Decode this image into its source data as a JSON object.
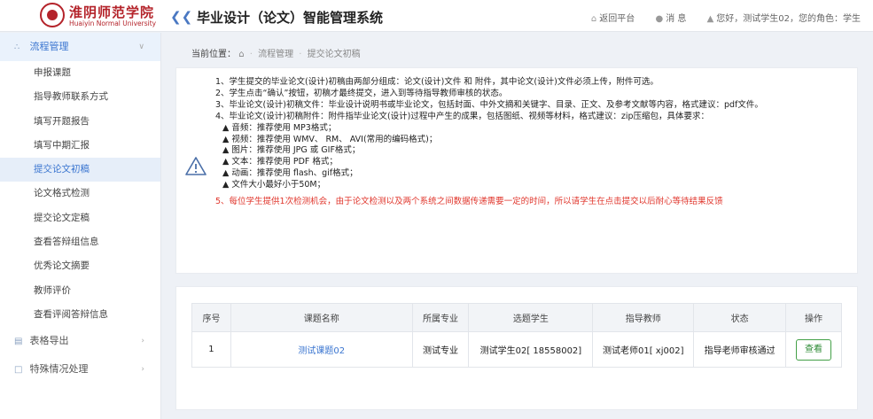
{
  "header": {
    "logo_cn": "淮阴师范学院",
    "logo_en": "Huaiyin Normal University",
    "app_title": "毕业设计（论文）智能管理系统",
    "return_label": "返回平台",
    "messages_label": "消 息",
    "user_greeting": "您好，测试学生02，您的角色：学生"
  },
  "sidebar": {
    "groups": [
      {
        "label": "流程管理",
        "icon": "share-icon"
      },
      {
        "label": "表格导出",
        "icon": "table-icon"
      },
      {
        "label": "特殊情况处理",
        "icon": "document-icon"
      }
    ],
    "items": [
      {
        "label": "申报课题"
      },
      {
        "label": "指导教师联系方式"
      },
      {
        "label": "填写开题报告"
      },
      {
        "label": "填写中期汇报"
      },
      {
        "label": "提交论文初稿"
      },
      {
        "label": "论文格式检测"
      },
      {
        "label": "提交论文定稿"
      },
      {
        "label": "查看答辩组信息"
      },
      {
        "label": "优秀论文摘要"
      },
      {
        "label": "教师评价"
      },
      {
        "label": "查看评阅答辩信息"
      }
    ]
  },
  "breadcrumb": {
    "prefix": "当前位置：",
    "level1": "流程管理",
    "level2": "提交论文初稿"
  },
  "notice": {
    "lines": [
      "1、学生提交的毕业论文(设计)初稿由两部分组成：论文(设计)文件 和 附件，其中论文(设计)文件必须上传，附件可选。",
      "2、学生点击“确认”按钮，初稿才最终提交，进入到等待指导教师审核的状态。",
      "3、毕业论文(设计)初稿文件：毕业设计说明书或毕业论文，包括封面、中外文摘和关键字、目录、正文、及参考文献等内容，格式建议：pdf文件。",
      "4、毕业论文(设计)初稿附件：附件指毕业论文(设计)过程中产生的成果，包括图纸、视频等材料，格式建议：zip压缩包，具体要求："
    ],
    "bullets": [
      "▲ 音频：推荐使用 MP3格式；",
      "▲ 视频：推荐使用 WMV、 RM、 AVI(常用的编码格式)；",
      "▲ 图片：推荐使用 JPG 或 GIF格式；",
      "▲ 文本：推荐使用 PDF 格式；",
      "▲ 动画：推荐使用 flash、gif格式；",
      "▲ 文件大小最好小于50M；"
    ],
    "red_line": "5、每位学生提供1次检测机会，由于论文检测以及两个系统之间数据传递需要一定的时间，所以请学生在点击提交以后耐心等待结果反馈"
  },
  "table": {
    "headers": [
      "序号",
      "课题名称",
      "所属专业",
      "选题学生",
      "指导教师",
      "状态",
      "操作"
    ],
    "rows": [
      {
        "no": "1",
        "title": "测试课题02",
        "major": "测试专业",
        "student": "测试学生02[ 18558002]",
        "teacher": "测试老师01[ xj002]",
        "status": "指导老师审核通过",
        "action": "查看"
      }
    ]
  },
  "colors": {
    "accent": "#3a75d0",
    "warning_red": "#e0362c",
    "brand_red": "#b4232a",
    "action_green": "#43a047"
  }
}
